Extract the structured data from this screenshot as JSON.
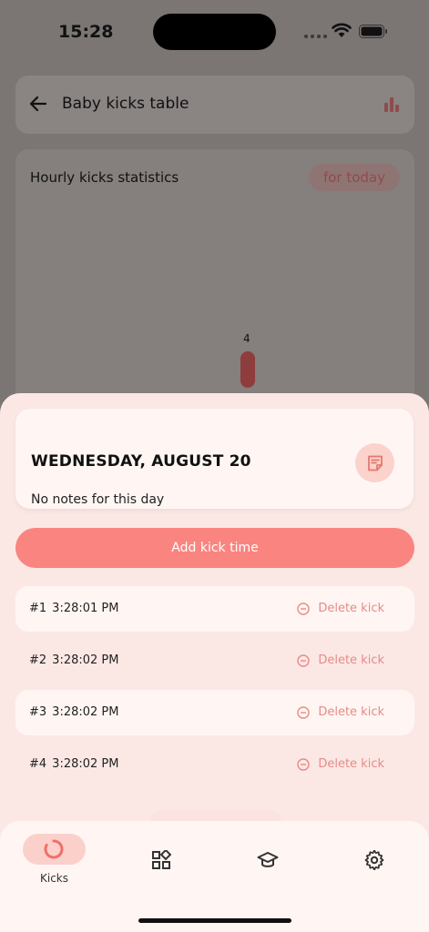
{
  "status_bar": {
    "time": "15:28"
  },
  "header": {
    "title": "Baby kicks table"
  },
  "stats": {
    "title": "Hourly kicks statistics",
    "filter_label": "for today",
    "bar_value": "4"
  },
  "day": {
    "title": "WEDNESDAY, AUGUST 20",
    "notes": "No notes for this day"
  },
  "actions": {
    "add_kick_label": "Add kick time"
  },
  "kicks": [
    {
      "num": "#1",
      "time": "3:28:01 PM",
      "delete_label": "Delete kick"
    },
    {
      "num": "#2",
      "time": "3:28:02 PM",
      "delete_label": "Delete kick"
    },
    {
      "num": "#3",
      "time": "3:28:02 PM",
      "delete_label": "Delete kick"
    },
    {
      "num": "#4",
      "time": "3:28:02 PM",
      "delete_label": "Delete kick"
    }
  ],
  "tabs": [
    {
      "label": "Kicks",
      "icon": "kicks-ring-icon",
      "active": true
    },
    {
      "label": "",
      "icon": "widgets-icon"
    },
    {
      "label": "",
      "icon": "graduation-cap-icon"
    },
    {
      "label": "",
      "icon": "gear-icon"
    }
  ],
  "colors": {
    "accent": "#fa8480",
    "accent_soft": "#fbd0cb",
    "delete": "#e88a86",
    "sheet_bg": "#fbe8e5",
    "card_bg": "#fff6f3"
  }
}
